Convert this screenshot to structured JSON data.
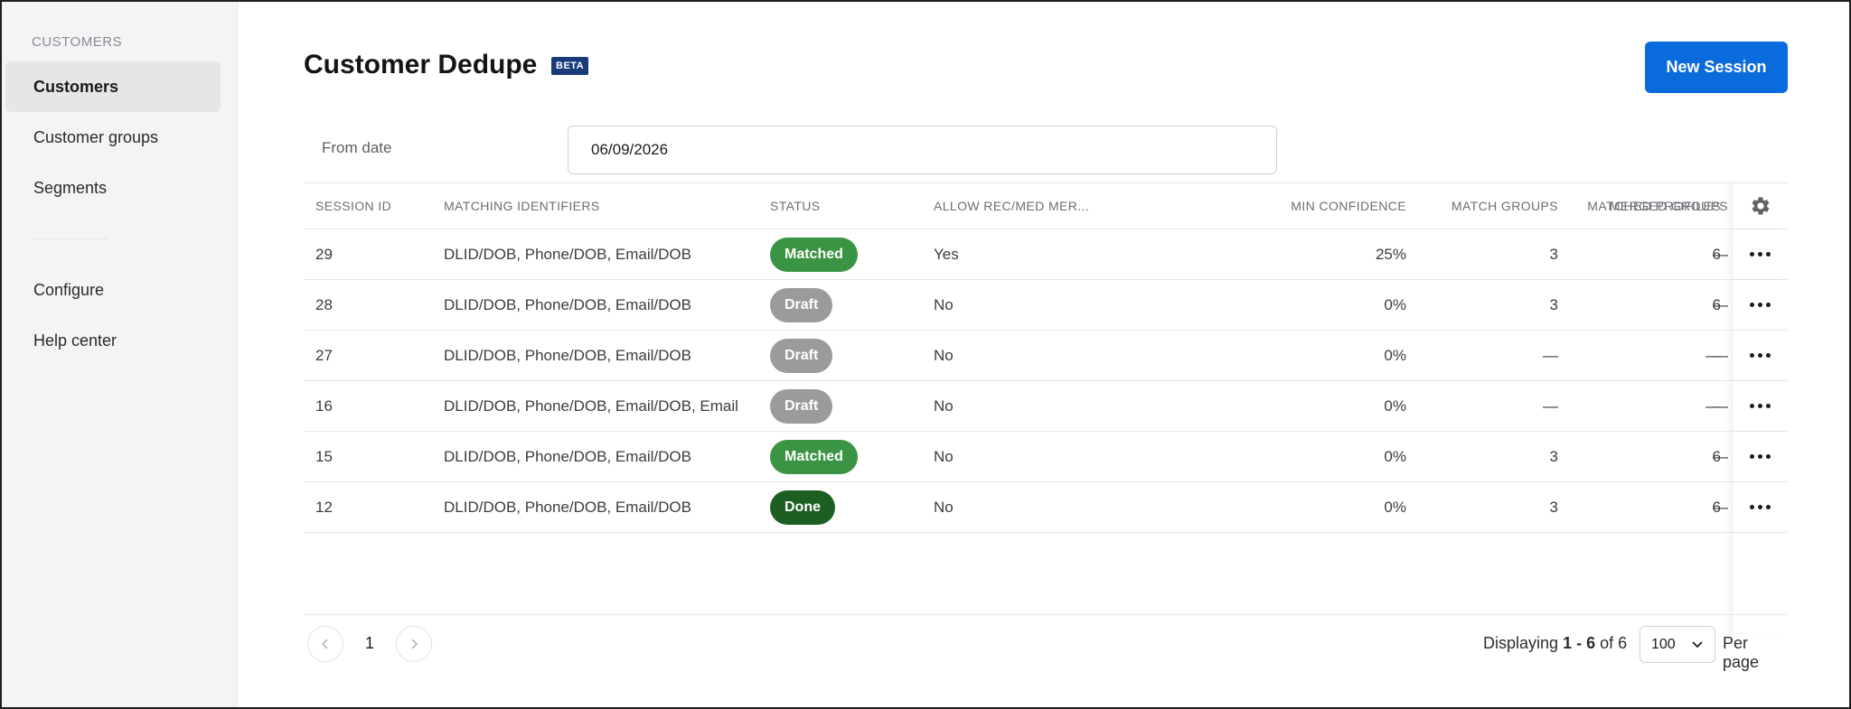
{
  "sidebar": {
    "section_label": "CUSTOMERS",
    "items": [
      {
        "label": "Customers",
        "active": true
      },
      {
        "label": "Customer groups",
        "active": false
      },
      {
        "label": "Segments",
        "active": false
      }
    ],
    "secondary_items": [
      {
        "label": "Configure"
      },
      {
        "label": "Help center"
      }
    ]
  },
  "header": {
    "title": "Customer Dedupe",
    "badge": "BETA",
    "new_session_label": "New Session"
  },
  "filter": {
    "label": "From date",
    "value": "06/09/2026"
  },
  "table": {
    "columns": {
      "session_id": "SESSION ID",
      "matching_identifiers": "MATCHING IDENTIFIERS",
      "status": "STATUS",
      "allow_rec_med": "ALLOW REC/MED MER...",
      "min_confidence": "MIN CONFIDENCE",
      "match_groups": "MATCH GROUPS",
      "matched_profiles": "MATCHED PROFILES",
      "merged_groups": "MERGED GROUPS"
    },
    "rows": [
      {
        "id": "29",
        "identifiers": "DLID/DOB, Phone/DOB, Email/DOB",
        "status": "Matched",
        "allow": "Yes",
        "confidence": "25%",
        "match_groups": "3",
        "matched_profiles": "6",
        "merged_groups": "—"
      },
      {
        "id": "28",
        "identifiers": "DLID/DOB, Phone/DOB, Email/DOB",
        "status": "Draft",
        "allow": "No",
        "confidence": "0%",
        "match_groups": "3",
        "matched_profiles": "6",
        "merged_groups": "—"
      },
      {
        "id": "27",
        "identifiers": "DLID/DOB, Phone/DOB, Email/DOB",
        "status": "Draft",
        "allow": "No",
        "confidence": "0%",
        "match_groups": "—",
        "matched_profiles": "—",
        "merged_groups": "—"
      },
      {
        "id": "16",
        "identifiers": "DLID/DOB, Phone/DOB, Email/DOB, Email",
        "status": "Draft",
        "allow": "No",
        "confidence": "0%",
        "match_groups": "—",
        "matched_profiles": "—",
        "merged_groups": "—"
      },
      {
        "id": "15",
        "identifiers": "DLID/DOB, Phone/DOB, Email/DOB",
        "status": "Matched",
        "allow": "No",
        "confidence": "0%",
        "match_groups": "3",
        "matched_profiles": "6",
        "merged_groups": "—"
      },
      {
        "id": "12",
        "identifiers": "DLID/DOB, Phone/DOB, Email/DOB",
        "status": "Done",
        "allow": "No",
        "confidence": "0%",
        "match_groups": "3",
        "matched_profiles": "6",
        "merged_groups": "—"
      }
    ]
  },
  "pagination": {
    "current_page": "1",
    "display_prefix": "Displaying",
    "display_range": "1 - 6",
    "display_of": "of 6",
    "per_page_value": "100",
    "per_page_label": "Per page"
  },
  "colors": {
    "primary": "#0a6bdc",
    "matched": "#3a9443",
    "draft": "#9b9b9b",
    "done": "#1d5e22",
    "beta_badge": "#1a3a7a"
  }
}
